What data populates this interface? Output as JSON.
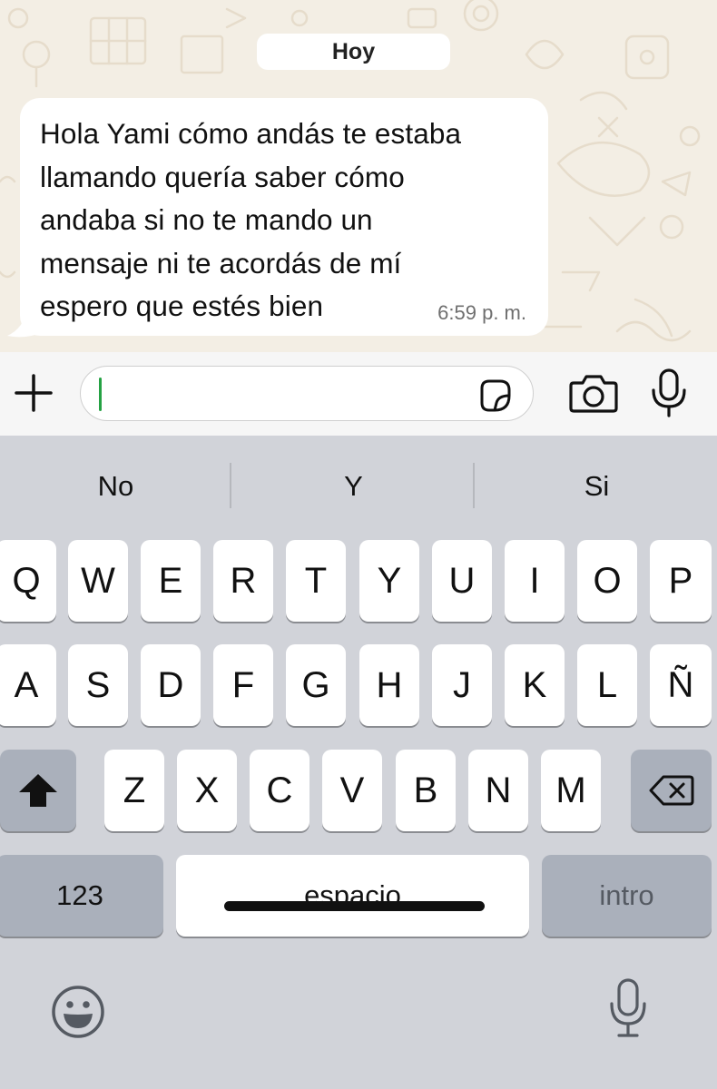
{
  "chat": {
    "day_label": "Hoy",
    "message": {
      "lines": [
        "Hola Yami cómo andás te estaba",
        "llamando quería saber cómo",
        "andaba si no te mando un",
        "mensaje ni te acordás de mí",
        "espero que estés bien"
      ],
      "time": "6:59 p. m."
    }
  },
  "input_bar": {
    "icons": [
      "plus-icon",
      "sticker-icon",
      "camera-icon",
      "microphone-icon"
    ],
    "caret_color": "#25a244"
  },
  "keyboard": {
    "predictions": [
      "No",
      "Y",
      "Si"
    ],
    "rows": [
      [
        "Q",
        "W",
        "E",
        "R",
        "T",
        "Y",
        "U",
        "I",
        "O",
        "P"
      ],
      [
        "A",
        "S",
        "D",
        "F",
        "G",
        "H",
        "J",
        "K",
        "L",
        "Ñ"
      ],
      [
        "Z",
        "X",
        "C",
        "V",
        "B",
        "N",
        "M"
      ]
    ],
    "numbers_key": "123",
    "space_key": "espacio",
    "return_key": "intro",
    "icons": [
      "shift-icon",
      "backspace-icon",
      "emoji-icon",
      "dictation-icon"
    ]
  }
}
